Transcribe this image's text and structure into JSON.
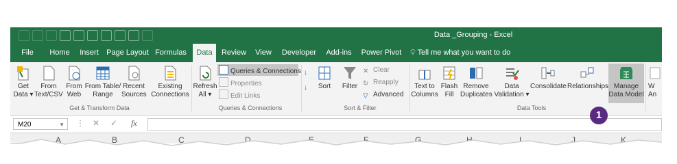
{
  "window": {
    "title": "Data _Grouping  -  Excel",
    "colors": {
      "brand": "#217346",
      "ribbon": "#f3f3f3",
      "badge": "#5a2a82"
    }
  },
  "tabs": [
    "File",
    "Home",
    "Insert",
    "Page Layout",
    "Formulas",
    "Data",
    "Review",
    "View",
    "Developer",
    "Add-ins",
    "Power Pivot"
  ],
  "active_tab": "Data",
  "tell_me": "Tell me what you want to do",
  "ribbon": {
    "get_transform": {
      "buttons": [
        {
          "l1": "Get",
          "l2": "Data ▾"
        },
        {
          "l1": "From",
          "l2": "Text/CSV"
        },
        {
          "l1": "From",
          "l2": "Web"
        },
        {
          "l1": "From Table/",
          "l2": "Range"
        },
        {
          "l1": "Recent",
          "l2": "Sources"
        },
        {
          "l1": "Existing",
          "l2": "Connections"
        }
      ],
      "label": "Get & Transform Data"
    },
    "queries": {
      "refresh": {
        "l1": "Refresh",
        "l2": "All ▾"
      },
      "items": [
        "Queries & Connections",
        "Properties",
        "Edit Links"
      ],
      "label": "Queries & Connections"
    },
    "sort_filter": {
      "sort": "Sort",
      "filter": "Filter",
      "items": [
        "Clear",
        "Reapply",
        "Advanced"
      ],
      "label": "Sort & Filter"
    },
    "data_tools": {
      "buttons": [
        {
          "l1": "Text to",
          "l2": "Columns"
        },
        {
          "l1": "Flash",
          "l2": "Fill"
        },
        {
          "l1": "Remove",
          "l2": "Duplicates"
        },
        {
          "l1": "Data",
          "l2": "Validation ▾"
        },
        {
          "l1": "Consolidate",
          "l2": ""
        },
        {
          "l1": "Relationships",
          "l2": ""
        },
        {
          "l1": "Manage",
          "l2": "Data Model"
        }
      ],
      "label": "Data Tools"
    },
    "cut_off": {
      "l1": "W",
      "l2": "An"
    }
  },
  "formula_bar": {
    "name_box": "M20",
    "fx": "fx",
    "value": ""
  },
  "columns": [
    "A",
    "B",
    "C",
    "D",
    "E",
    "F",
    "G",
    "H",
    "I",
    "J",
    "K"
  ],
  "badge": "1"
}
